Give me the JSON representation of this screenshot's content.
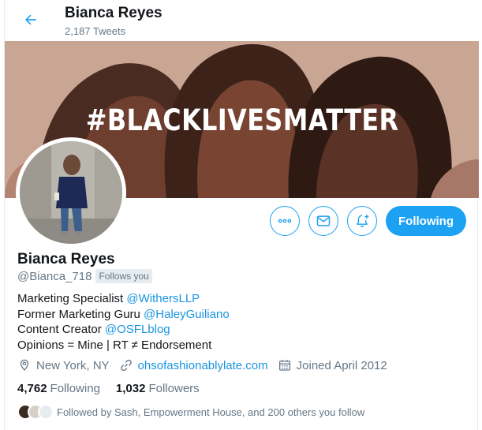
{
  "header": {
    "name": "Bianca Reyes",
    "tweet_count": "2,187 Tweets"
  },
  "banner": {
    "text": "#BLACKLIVESMATTER"
  },
  "actions": {
    "following_label": "Following"
  },
  "profile": {
    "name": "Bianca Reyes",
    "handle": "@Bianca_718",
    "follows_you": "Follows you",
    "bio": {
      "line1_text": "Marketing Specialist ",
      "line1_link": "@WithersLLP",
      "line2_text": "Former Marketing Guru ",
      "line2_link": "@HaleyGuiliano",
      "line3_text": "Content Creator ",
      "line3_link": "@OSFLblog",
      "line4_text": "Opinions = Mine | RT ≠ Endorsement"
    },
    "location": "New York, NY",
    "website": "ohsofashionablylate.com",
    "joined": "Joined April 2012",
    "following_count": "4,762",
    "following_label": "Following",
    "followers_count": "1,032",
    "followers_label": "Followers",
    "followed_by": "Followed by Sash, Empowerment House, and 200 others you follow"
  },
  "colors": {
    "accent": "#1da1f2",
    "link": "#1b95e0",
    "secondary_text": "#657786",
    "banner_bg": "#c6a391"
  },
  "icons": [
    "back-arrow-icon",
    "more-icon",
    "mail-icon",
    "bell-plus-icon",
    "location-icon",
    "link-icon",
    "calendar-icon"
  ]
}
